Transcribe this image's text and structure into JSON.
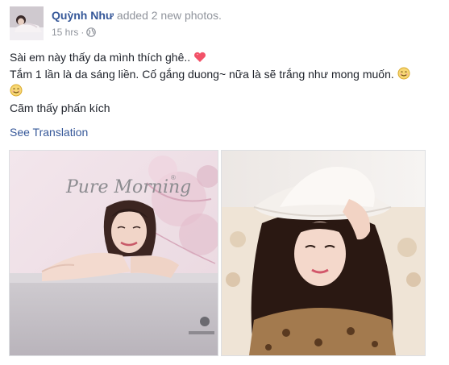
{
  "post": {
    "author": "Quỳnh Như",
    "action": " added 2 new photos.",
    "time": "15 hrs",
    "separator": "·",
    "audience_icon": "globe-icon",
    "lines": {
      "line1": "Sài em này thấy da mình thích ghê..",
      "line2": "Tắm 1 lần là da sáng liền. Cố gắng duong~ nữa là sẽ trắng như mong muốn.",
      "line3": "Cãm thấy phấn kích"
    },
    "emojis": [
      "heart-icon",
      "smile-icon",
      "smile-icon"
    ],
    "see_translation": "See Translation"
  },
  "photos": {
    "photo1": {
      "brand": "Pure Morning",
      "brand_mark": "®"
    },
    "photo2": {}
  },
  "colors": {
    "link": "#365899",
    "meta": "#90949c",
    "text": "#1d2129",
    "heart": "#f25268"
  }
}
